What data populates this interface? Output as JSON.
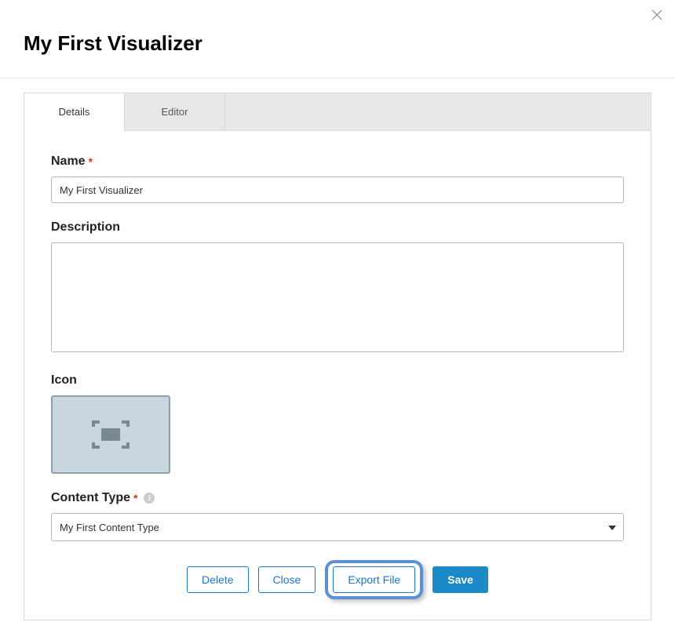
{
  "header": {
    "title": "My First Visualizer"
  },
  "tabs": {
    "details": "Details",
    "editor": "Editor"
  },
  "form": {
    "name_label": "Name",
    "name_value": "My First Visualizer",
    "description_label": "Description",
    "description_value": "",
    "icon_label": "Icon",
    "content_type_label": "Content Type",
    "content_type_value": "My First Content Type"
  },
  "buttons": {
    "delete": "Delete",
    "close": "Close",
    "export": "Export File",
    "save": "Save"
  }
}
